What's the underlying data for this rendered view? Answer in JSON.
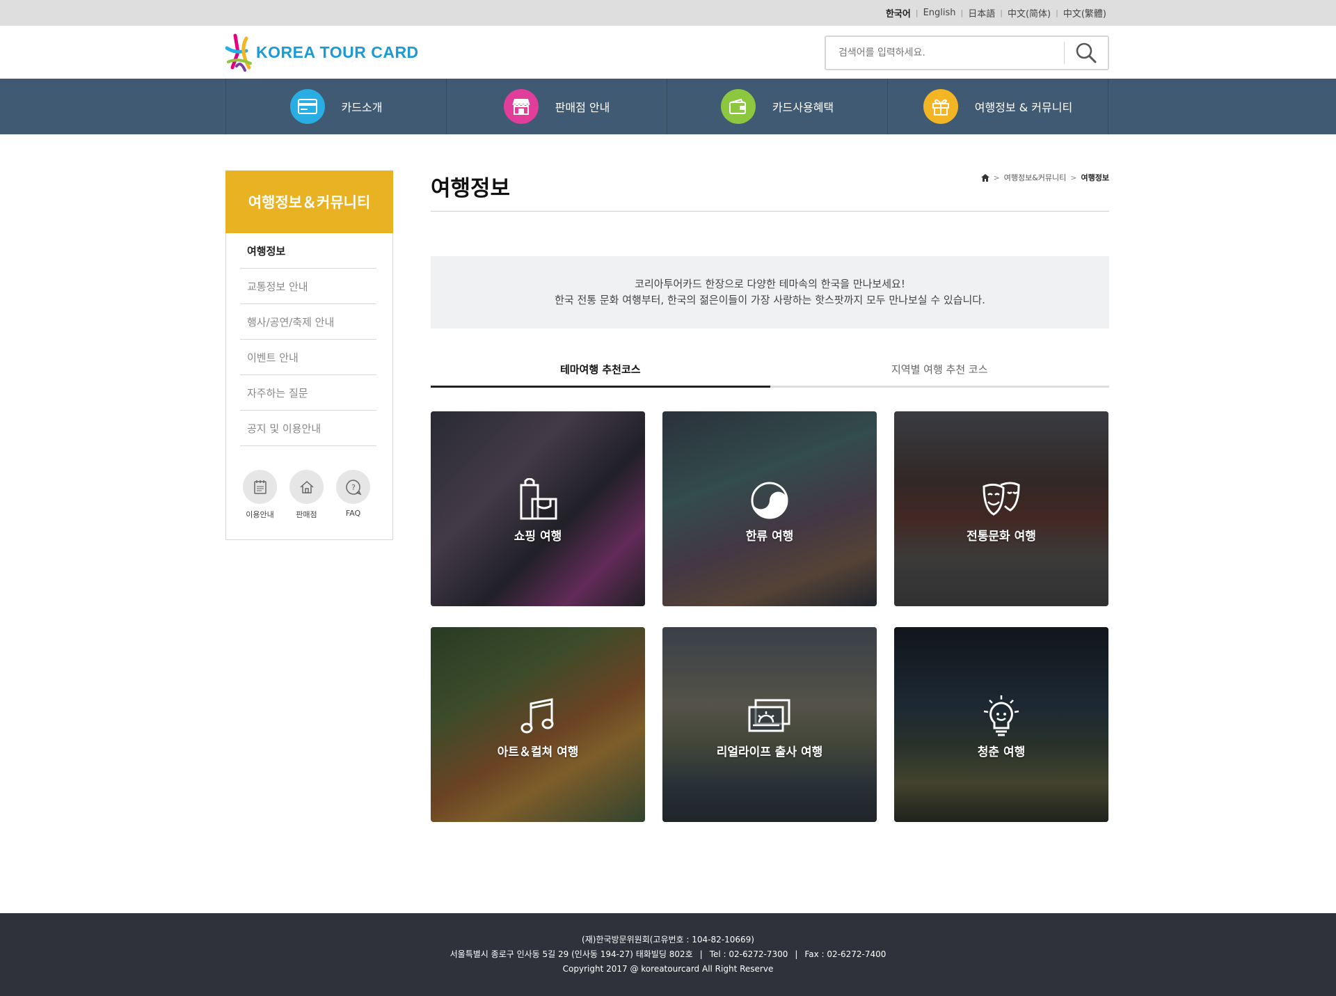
{
  "languages": [
    {
      "label": "한국어",
      "active": true
    },
    {
      "label": "English"
    },
    {
      "label": "日本語"
    },
    {
      "label": "中文(简体)"
    },
    {
      "label": "中文(繁體)"
    }
  ],
  "header": {
    "logo_text": "KOREA TOUR CARD",
    "search_placeholder": "검색어를 입력하세요."
  },
  "gnb": [
    {
      "label": "카드소개",
      "color": "#29aee3",
      "icon": "card-icon"
    },
    {
      "label": "판매점 안내",
      "color": "#e13d9b",
      "icon": "store-icon"
    },
    {
      "label": "카드사용혜택",
      "color": "#8dc63f",
      "icon": "wallet-icon"
    },
    {
      "label": "여행정보 & 커뮤니티",
      "color": "#f3b523",
      "icon": "gift-icon"
    }
  ],
  "sidebar": {
    "title": "여행정보＆커뮤니티",
    "items": [
      {
        "label": "여행정보",
        "active": true
      },
      {
        "label": "교통정보 안내"
      },
      {
        "label": "행사/공연/축제 안내"
      },
      {
        "label": "이벤트 안내"
      },
      {
        "label": "자주하는 질문"
      },
      {
        "label": "공지 및 이용안내"
      }
    ],
    "quick": [
      {
        "label": "이용안내",
        "icon": "notepad-icon"
      },
      {
        "label": "판매점",
        "icon": "home-icon"
      },
      {
        "label": "FAQ",
        "icon": "question-icon"
      }
    ]
  },
  "main": {
    "title": "여행정보",
    "breadcrumb": [
      "여행정보&커뮤니티",
      "여행정보"
    ],
    "intro_line1": "코리아투어카드 한장으로 다양한 테마속의 한국을 만나보세요!",
    "intro_line2": "한국 전통 문화 여행부터, 한국의 젊은이들이 가장 사랑하는 핫스팟까지 모두 만나보실 수 있습니다.",
    "tabs": [
      {
        "label": "테마여행 추천코스",
        "active": true
      },
      {
        "label": "지역별 여행 추천 코스"
      }
    ],
    "cards": [
      {
        "label": "쇼핑 여행",
        "icon": "shopping-bag-icon"
      },
      {
        "label": "한류 여행",
        "icon": "taegeuk-icon"
      },
      {
        "label": "전통문화 여행",
        "icon": "masks-icon"
      },
      {
        "label": "아트＆컬쳐 여행",
        "icon": "music-note-icon"
      },
      {
        "label": "리얼라이프 출사 여행",
        "icon": "photo-icon"
      },
      {
        "label": "청춘 여행",
        "icon": "lightbulb-icon"
      }
    ]
  },
  "footer": {
    "line1": "(재)한국방문위원회(고유번호 : 104-82-10669)",
    "address": "서울특별시 종로구 인사동 5길 29 (인사동 194-27) 태화빌딩 802호",
    "tel": "Tel : 02-6272-7300",
    "fax": "Fax : 02-6272-7400",
    "copyright": "Copyright 2017 @ koreatourcard All Right Reserve"
  }
}
